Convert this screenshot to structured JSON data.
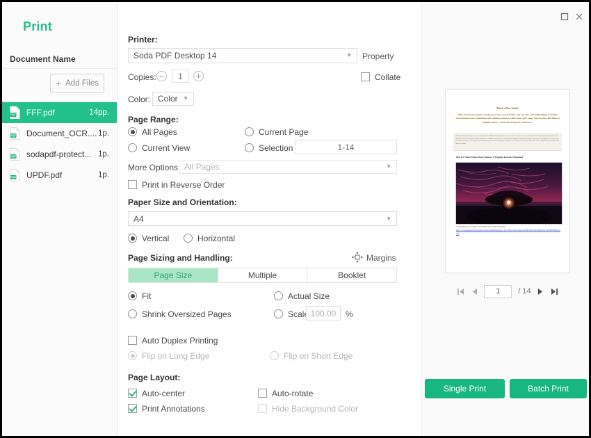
{
  "window": {
    "maximize_icon": "maximize-icon",
    "close_icon": "close-icon"
  },
  "sidebar": {
    "title": "Print",
    "document_name_label": "Document Name",
    "add_files_label": "Add Files",
    "add_files_icon": "plus-icon",
    "files": [
      {
        "name": "FFF.pdf",
        "pages": "14pp.",
        "selected": true
      },
      {
        "name": "Document_OCR....",
        "pages": "1p.",
        "selected": false
      },
      {
        "name": "sodapdf-protect...",
        "pages": "1p.",
        "selected": false
      },
      {
        "name": "UPDF.pdf",
        "pages": "1p.",
        "selected": false
      }
    ]
  },
  "form": {
    "printer_label": "Printer:",
    "printer_value": "Soda PDF Desktop 14",
    "property_label": "Property",
    "copies_label": "Copies:",
    "copies_value": "1",
    "collate_label": "Collate",
    "color_label": "Color:",
    "color_value": "Color",
    "page_range_label": "Page Range:",
    "all_pages_label": "All Pages",
    "current_page_label": "Current Page",
    "current_view_label": "Current View",
    "selection_label": "Selection",
    "selection_value": "1-14",
    "more_options_label": "More Options:",
    "more_options_value": "All Pages",
    "reverse_order_label": "Print in Reverse Order",
    "paper_size_label": "Paper Size and Orientation:",
    "paper_size_value": "A4",
    "vertical_label": "Vertical",
    "horizontal_label": "Horizontal",
    "sizing_label": "Page Sizing and Handling:",
    "margins_label": "Margins",
    "margins_icon": "margins-icon",
    "tabs": [
      {
        "label": "Page Size",
        "active": true
      },
      {
        "label": "Multiple",
        "active": false
      },
      {
        "label": "Booklet",
        "active": false
      }
    ],
    "fit_label": "Fit",
    "actual_size_label": "Actual Size",
    "shrink_label": "Shrink Oversized Pages",
    "scale_label": "Scale",
    "scale_value": "100.00",
    "percent_label": "%",
    "duplex_label": "Auto Duplex Printing",
    "flip_long_label": "Flip on Long Edge",
    "flip_short_label": "Flip on Short Edge",
    "page_layout_label": "Page Layout:",
    "auto_center_label": "Auto-center",
    "auto_rotate_label": "Auto-rotate",
    "print_annotations_label": "Print Annotations",
    "hide_bg_label": "Hide Background Color"
  },
  "preview": {
    "doc_title": "This is a New Article",
    "doc_lead": "(This structure is meant to help you write a good article. You can also add subheadings if needed. Avoid unnecessary repetitions and common phrases which don't add value. You can also add links to helping videos - Check the image for reference.)",
    "doc_note": "Which is most important when it comes to contrast and readability? This tutorial, you can have it make sure you're set with others they are built just simply high in specific issues. Although there are also separate Portfolio items to use a standard or spread. Here is a great way to navigate the structure and layout across Pages. This simply way to use you can join other knowledge in a book large scale information for posts and reviewing project. To make sure so that, it'll mean its core different levels of a standard. Every component will end up in its paper.",
    "doc_heading2": "IRL EV Water Home Rotor Button: 4 Tripping Reasons Explained",
    "doc_caption": "Grand Sunrise, Color, Artist, or art? Where is it at a spot? Read here!",
    "doc_url": "https://www.pikrequest.com/en/photo/beside/establishmenting/1-card-79/fna/5/2ikvv2nze%20t%D0%BEe%D0%BAn%D1%96%D0%BAuy%20(3)",
    "nav": {
      "first_icon": "first-page-icon",
      "prev_icon": "previous-page-icon",
      "next_icon": "next-page-icon",
      "last_icon": "last-page-icon",
      "current_page": "1",
      "total_pages": "/ 14"
    },
    "single_print_label": "Single Print",
    "batch_print_label": "Batch Print"
  },
  "colors": {
    "brand_green": "#22c08b",
    "button_green": "#18b680",
    "tab_active_bg": "#a9e6c5"
  }
}
